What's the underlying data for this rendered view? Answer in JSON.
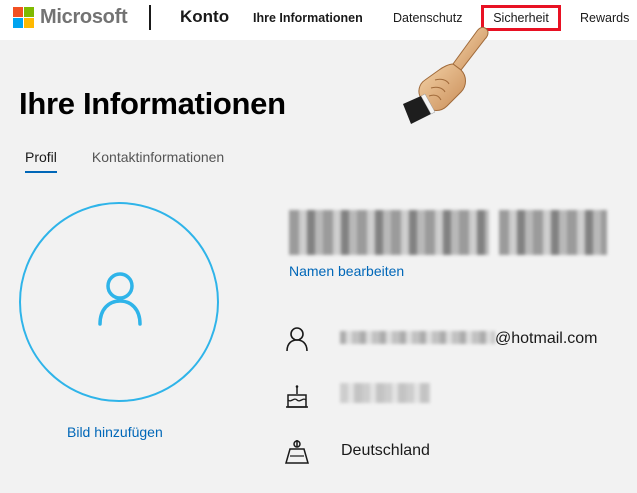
{
  "header": {
    "brand": "Microsoft",
    "brand_colors": [
      "#f25022",
      "#7fba00",
      "#00a4ef",
      "#ffb900"
    ],
    "section": "Konto",
    "nav": {
      "info": "Ihre Informationen",
      "privacy": "Datenschutz",
      "security": "Sicherheit",
      "rewards": "Rewards"
    },
    "highlight_color": "#e81123"
  },
  "main": {
    "title": "Ihre Informationen",
    "tabs": {
      "profile": "Profil",
      "contact": "Kontaktinformationen"
    },
    "avatar": {
      "icon": "person-icon",
      "add_photo": "Bild hinzufügen"
    },
    "profile": {
      "edit_name": "Namen bearbeiten",
      "email_domain": "@hotmail.com",
      "country": "Deutschland"
    }
  },
  "colors": {
    "link": "#0067b8",
    "avatar_ring": "#2fb4e9",
    "background": "#f2f2f2"
  }
}
